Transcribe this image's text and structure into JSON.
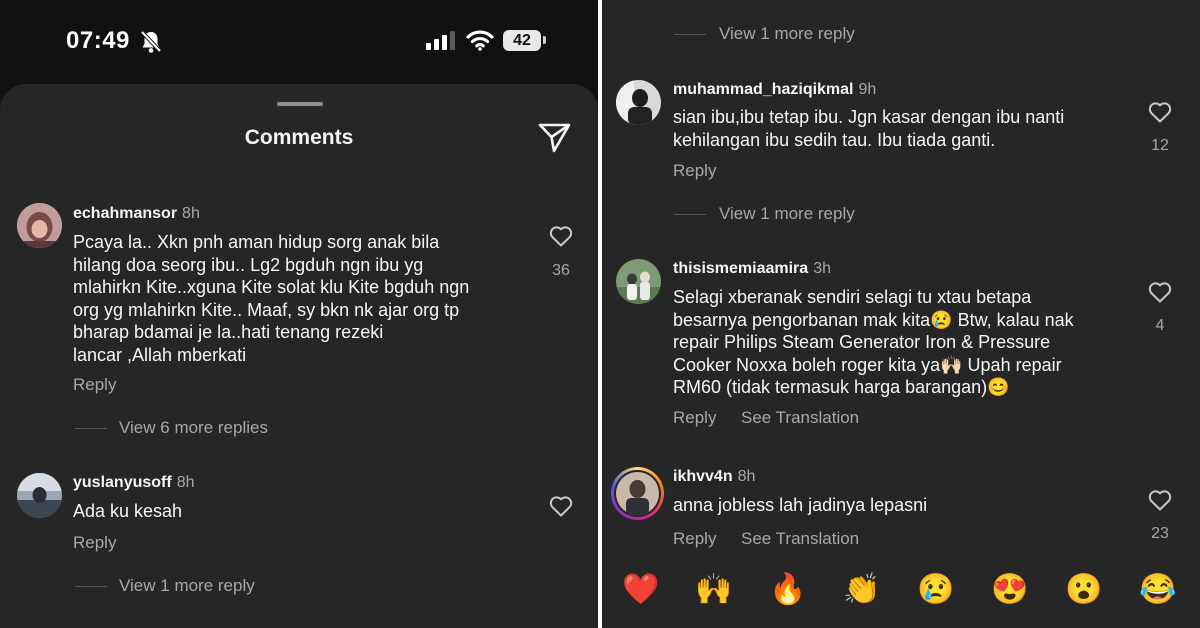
{
  "status": {
    "time": "07:49",
    "battery": "42"
  },
  "sheet": {
    "title": "Comments"
  },
  "left_comments": [
    {
      "username": "echahmansor",
      "age": "8h",
      "lines": [
        "Pcaya la.. Xkn pnh aman hidup sorg anak bila",
        "hilang doa seorg ibu.. Lg2 bgduh ngn ibu yg",
        "mlahirkn Kite..xguna Kite solat klu Kite bgduh ngn",
        "org yg mlahirkn Kite.. Maaf, sy bkn nk ajar org tp",
        "bharap bdamai je la..hati tenang rezeki",
        "lancar ,Allah mberkati"
      ],
      "reply": "Reply",
      "likes": "36",
      "view_more": "View 6 more replies"
    },
    {
      "username": "yuslanyusoff",
      "age": "8h",
      "lines": [
        "Ada ku kesah"
      ],
      "reply": "Reply",
      "likes": "",
      "view_more": "View 1 more reply"
    }
  ],
  "right_top_view_more": "View 1 more reply",
  "right_comments": [
    {
      "username": "muhammad_haziqikmal",
      "age": "9h",
      "lines": [
        "sian ibu,ibu tetap ibu. Jgn kasar dengan ibu nanti",
        "kehilangan ibu sedih tau. Ibu tiada ganti."
      ],
      "reply": "Reply",
      "likes": "12",
      "view_more": "View 1 more reply"
    },
    {
      "username": "thisismemiaamira",
      "age": "3h",
      "lines": [
        "Selagi xberanak sendiri selagi tu xtau betapa",
        "besarnya pengorbanan mak kita😢 Btw, kalau nak",
        "repair Philips Steam Generator Iron & Pressure",
        "Cooker Noxxa boleh roger kita ya🙌🏻 Upah repair",
        "RM60 (tidak termasuk harga barangan)😊"
      ],
      "reply": "Reply",
      "see_translation": "See Translation",
      "likes": "4"
    },
    {
      "username": "ikhvv4n",
      "age": "8h",
      "lines": [
        "anna jobless lah jadinya lepasni"
      ],
      "reply": "Reply",
      "see_translation": "See Translation",
      "likes": "23"
    }
  ],
  "emoji_bar": [
    "❤️",
    "🙌",
    "🔥",
    "👏",
    "😢",
    "😍",
    "😮",
    "😂"
  ],
  "colors": {
    "sheet": "#262626",
    "text": "#f5f5f5",
    "secondary": "#a8a8a8",
    "story_ring": "#d62976"
  }
}
